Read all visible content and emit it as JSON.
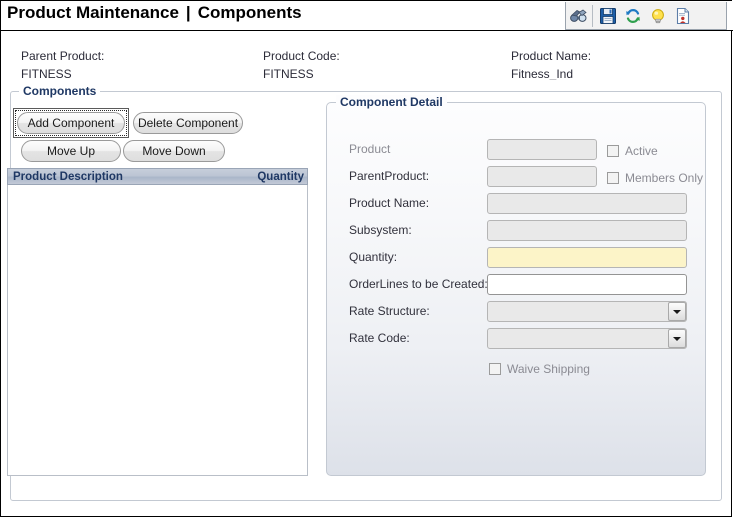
{
  "window": {
    "title_main": "Product Maintenance",
    "title_separator": "|",
    "title_sub": "Components"
  },
  "toolbar": {
    "items": [
      {
        "name": "binoculars-icon",
        "label": "Find"
      },
      {
        "name": "save-icon",
        "label": "Save"
      },
      {
        "name": "refresh-icon",
        "label": "Refresh"
      },
      {
        "name": "lightbulb-icon",
        "label": "Hint"
      },
      {
        "name": "report-icon",
        "label": "Report"
      }
    ]
  },
  "header": {
    "parent_product_label": "Parent Product:",
    "parent_product_value": "FITNESS",
    "product_code_label": "Product Code:",
    "product_code_value": "FITNESS",
    "product_name_label": "Product Name:",
    "product_name_value": "Fitness_Ind"
  },
  "components_group": {
    "legend": "Components",
    "buttons": {
      "add": "Add Component",
      "delete": "Delete Component",
      "move_up": "Move Up",
      "move_down": "Move Down"
    },
    "list": {
      "columns": [
        "Product Description",
        "Quantity"
      ],
      "rows": []
    }
  },
  "detail_group": {
    "legend": "Component Detail",
    "fields": [
      {
        "label": "Product",
        "value": "",
        "type": "text-disabled"
      },
      {
        "label": "ParentProduct:",
        "value": "",
        "type": "text-disabled"
      },
      {
        "label": "Product Name:",
        "value": "",
        "type": "text-disabled"
      },
      {
        "label": "Subsystem:",
        "value": "",
        "type": "text-disabled"
      },
      {
        "label": "Quantity:",
        "value": "",
        "type": "text-highlight"
      },
      {
        "label": "OrderLines to be Created:",
        "value": "",
        "type": "text-editable"
      },
      {
        "label": "Rate Structure:",
        "value": "",
        "type": "select"
      },
      {
        "label": "Rate Code:",
        "value": "",
        "type": "select"
      }
    ],
    "checkboxes": [
      {
        "label": "Active",
        "checked": false
      },
      {
        "label": "Members Only",
        "checked": false
      },
      {
        "label": "Waive Shipping",
        "checked": false
      }
    ]
  },
  "colors": {
    "legend_blue": "#1f3864",
    "highlight_yellow": "#fcf4c8",
    "disabled_field": "#e9e9e9",
    "list_header": "#bcc5d4"
  }
}
